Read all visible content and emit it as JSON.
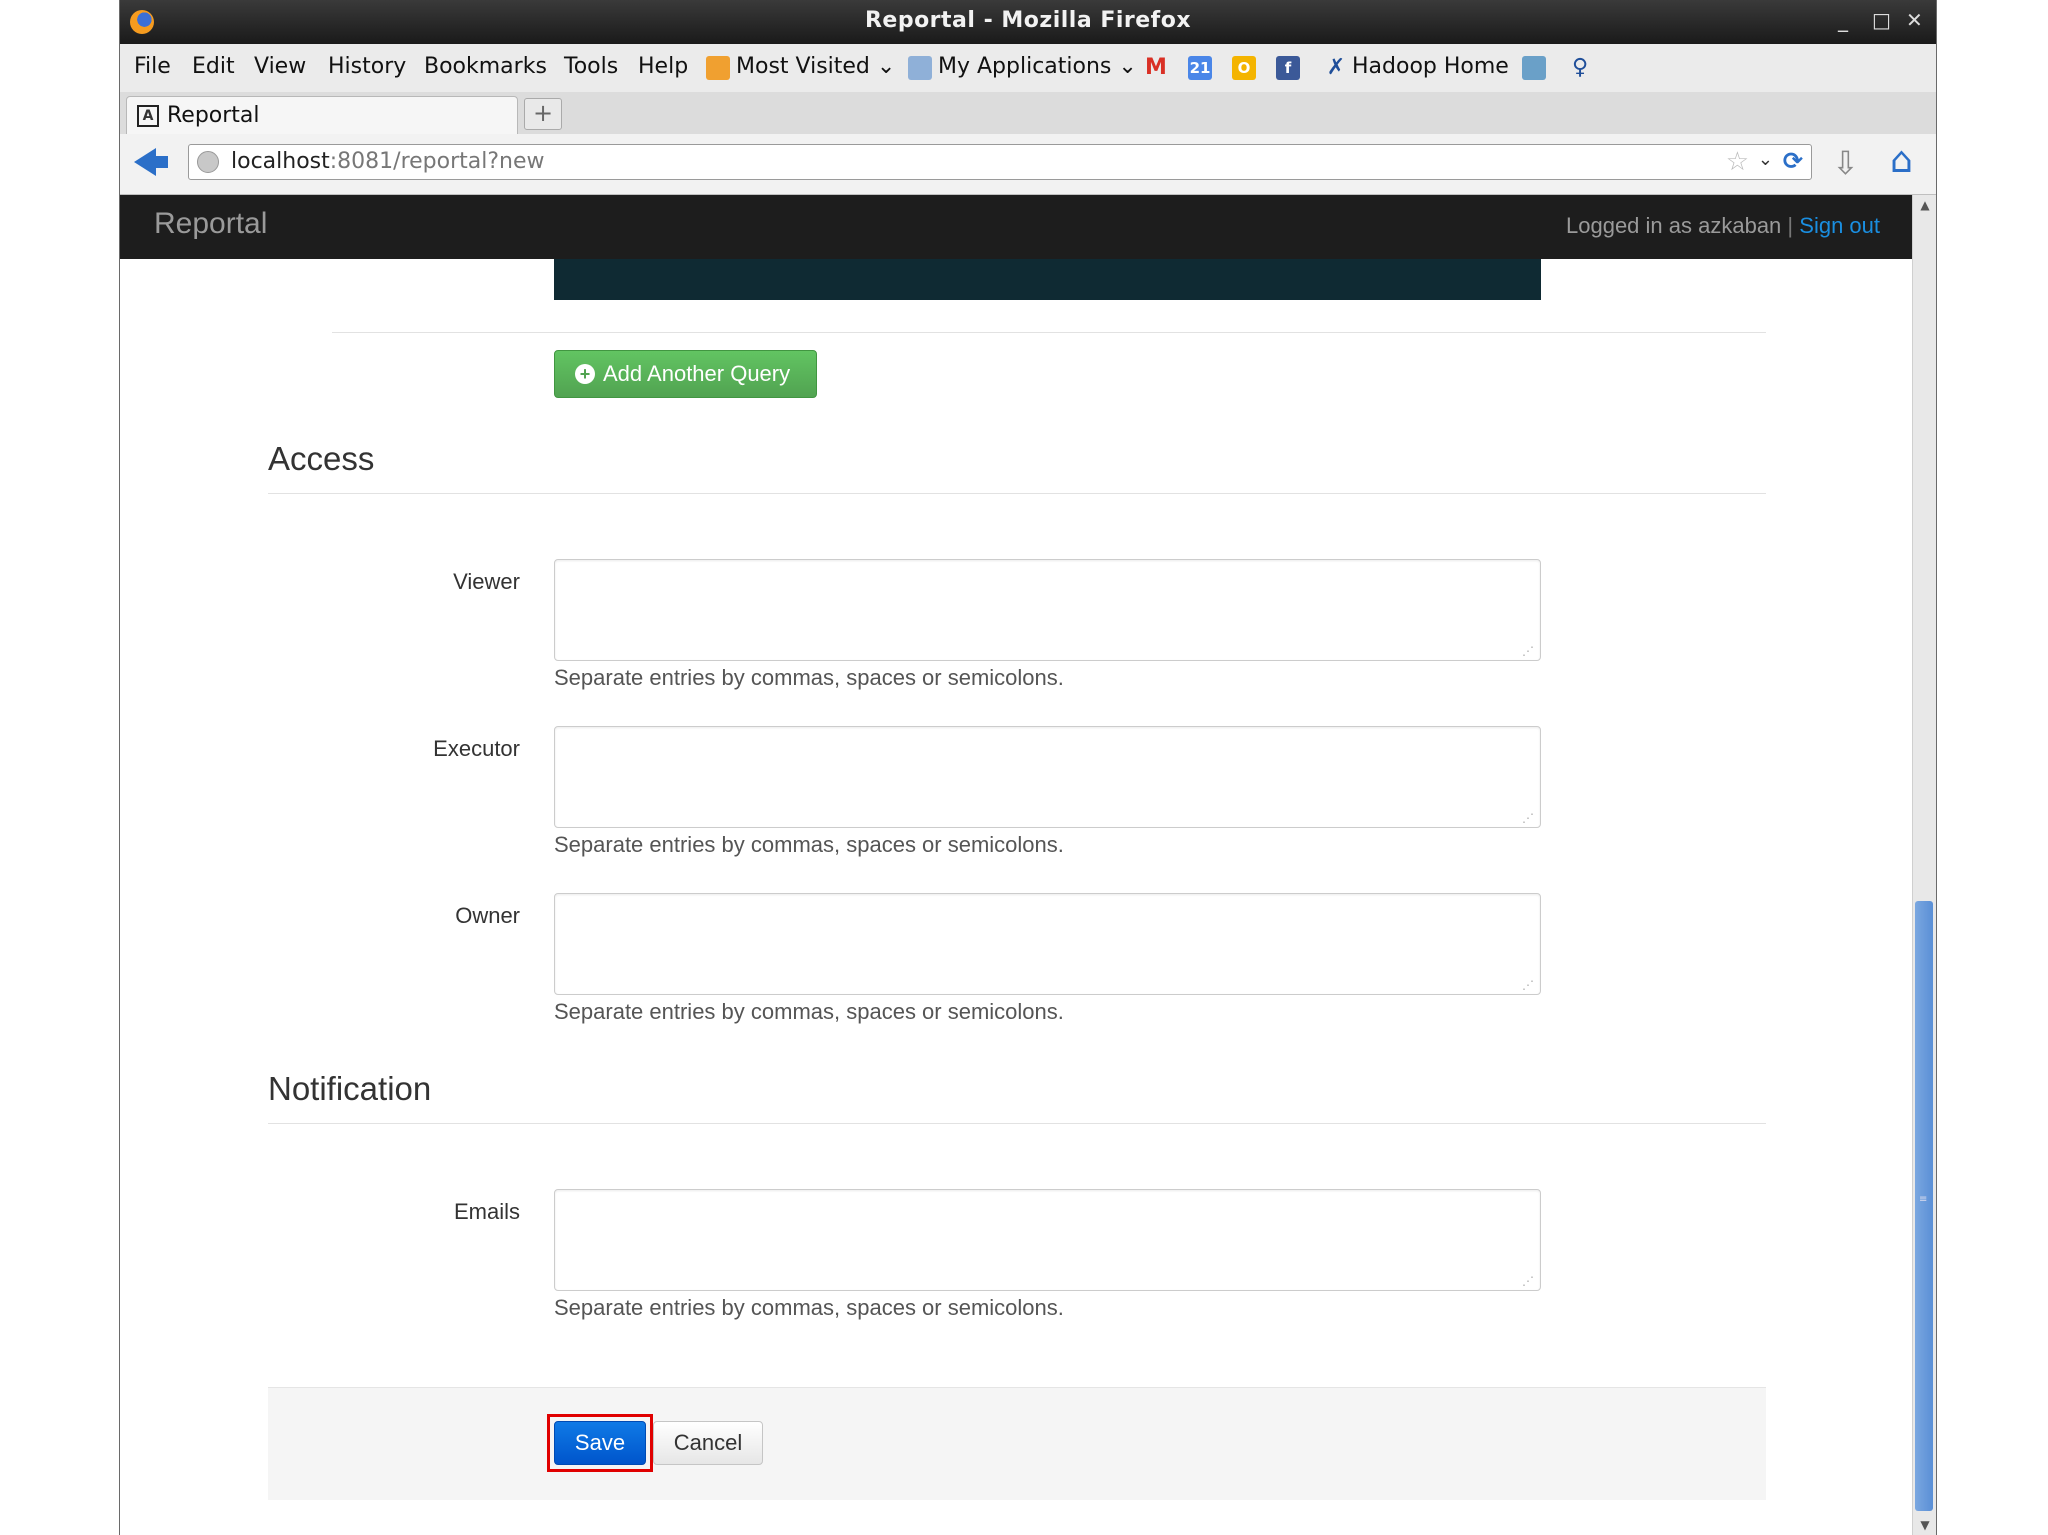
{
  "window": {
    "title": "Reportal - Mozilla Firefox"
  },
  "menu": [
    "File",
    "Edit",
    "View",
    "History",
    "Bookmarks",
    "Tools",
    "Help"
  ],
  "bookmarks": {
    "most_visited": "Most Visited",
    "my_applications": "My Applications",
    "calendar_badge": "21",
    "hadoop_home": "Hadoop Home"
  },
  "tab": {
    "label": "Reportal",
    "new_tab_glyph": "+"
  },
  "url": {
    "host": "localhost",
    "rest": ":8081/reportal?new"
  },
  "app": {
    "brand": "Reportal",
    "logged_in": "Logged in as azkaban",
    "separator": "|",
    "sign_out": "Sign out"
  },
  "form": {
    "add_query_label": "Add Another Query",
    "access_legend": "Access",
    "notification_legend": "Notification",
    "fields": [
      {
        "label": "Viewer",
        "value": "",
        "help": "Separate entries by commas, spaces or semicolons."
      },
      {
        "label": "Executor",
        "value": "",
        "help": "Separate entries by commas, spaces or semicolons."
      },
      {
        "label": "Owner",
        "value": "",
        "help": "Separate entries by commas, spaces or semicolons."
      },
      {
        "label": "Emails",
        "value": "",
        "help": "Separate entries by commas, spaces or semicolons."
      }
    ],
    "save_label": "Save",
    "cancel_label": "Cancel"
  },
  "colors": {
    "primary": "#0066cc",
    "success": "#51a351",
    "navbar": "#1d1d1d",
    "link": "#1a8ee0",
    "highlight": "#e00000"
  }
}
